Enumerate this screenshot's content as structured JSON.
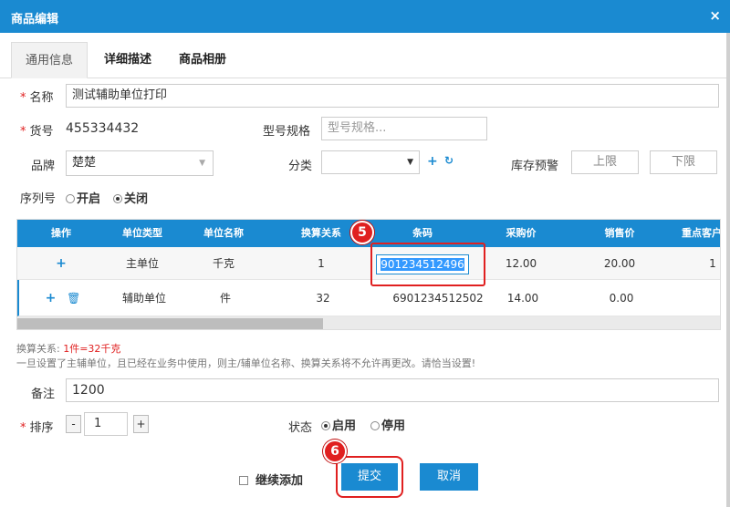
{
  "window": {
    "title": "商品编辑",
    "close_label": "×"
  },
  "tabs": [
    "通用信息",
    "详细描述",
    "商品相册"
  ],
  "form": {
    "name_label": "名称",
    "name_value": "测试辅助单位打印",
    "code_label": "货号",
    "code_value": "455334432",
    "model_label": "型号规格",
    "model_placeholder": "型号规格...",
    "brand_label": "品牌",
    "brand_value": "楚楚",
    "category_label": "分类",
    "category_value": "",
    "stock_alert_label": "库存预警",
    "stock_upper": "上限",
    "stock_lower": "下限",
    "serial_label": "序列号",
    "serial_on": "开启",
    "serial_off": "关闭",
    "remark_label": "备注",
    "remark_value": "1200",
    "sort_label": "排序",
    "sort_value": "1",
    "minus": "-",
    "plus": "+",
    "status_label": "状态",
    "status_enabled": "启用",
    "status_disabled": "停用"
  },
  "unit_table": {
    "headers": [
      "操作",
      "单位类型",
      "单位名称",
      "换算关系",
      "条码",
      "采购价",
      "销售价",
      "重点客户"
    ],
    "rows": [
      {
        "unit_type": "主单位",
        "unit_name": "千克",
        "ratio": "1",
        "barcode": "901234512496",
        "purchase": "12.00",
        "sale": "20.00",
        "vip": "1"
      },
      {
        "unit_type": "辅助单位",
        "unit_name": "件",
        "ratio": "32",
        "barcode": "6901234512502",
        "purchase": "14.00",
        "sale": "0.00",
        "vip": ""
      }
    ]
  },
  "notes": {
    "conversion_label": "换算关系:",
    "conversion_value": "1件=32千克",
    "warning": "一旦设置了主辅单位，且已经在业务中使用，则主/辅单位名称、换算关系将不允许再更改。请恰当设置!"
  },
  "footer": {
    "continue_add": "继续添加",
    "submit": "提交",
    "cancel": "取消"
  },
  "callouts": [
    "5",
    "6"
  ],
  "colors": {
    "primary": "#1a8ad1",
    "required": "#e02020",
    "callout": "#e02020"
  }
}
